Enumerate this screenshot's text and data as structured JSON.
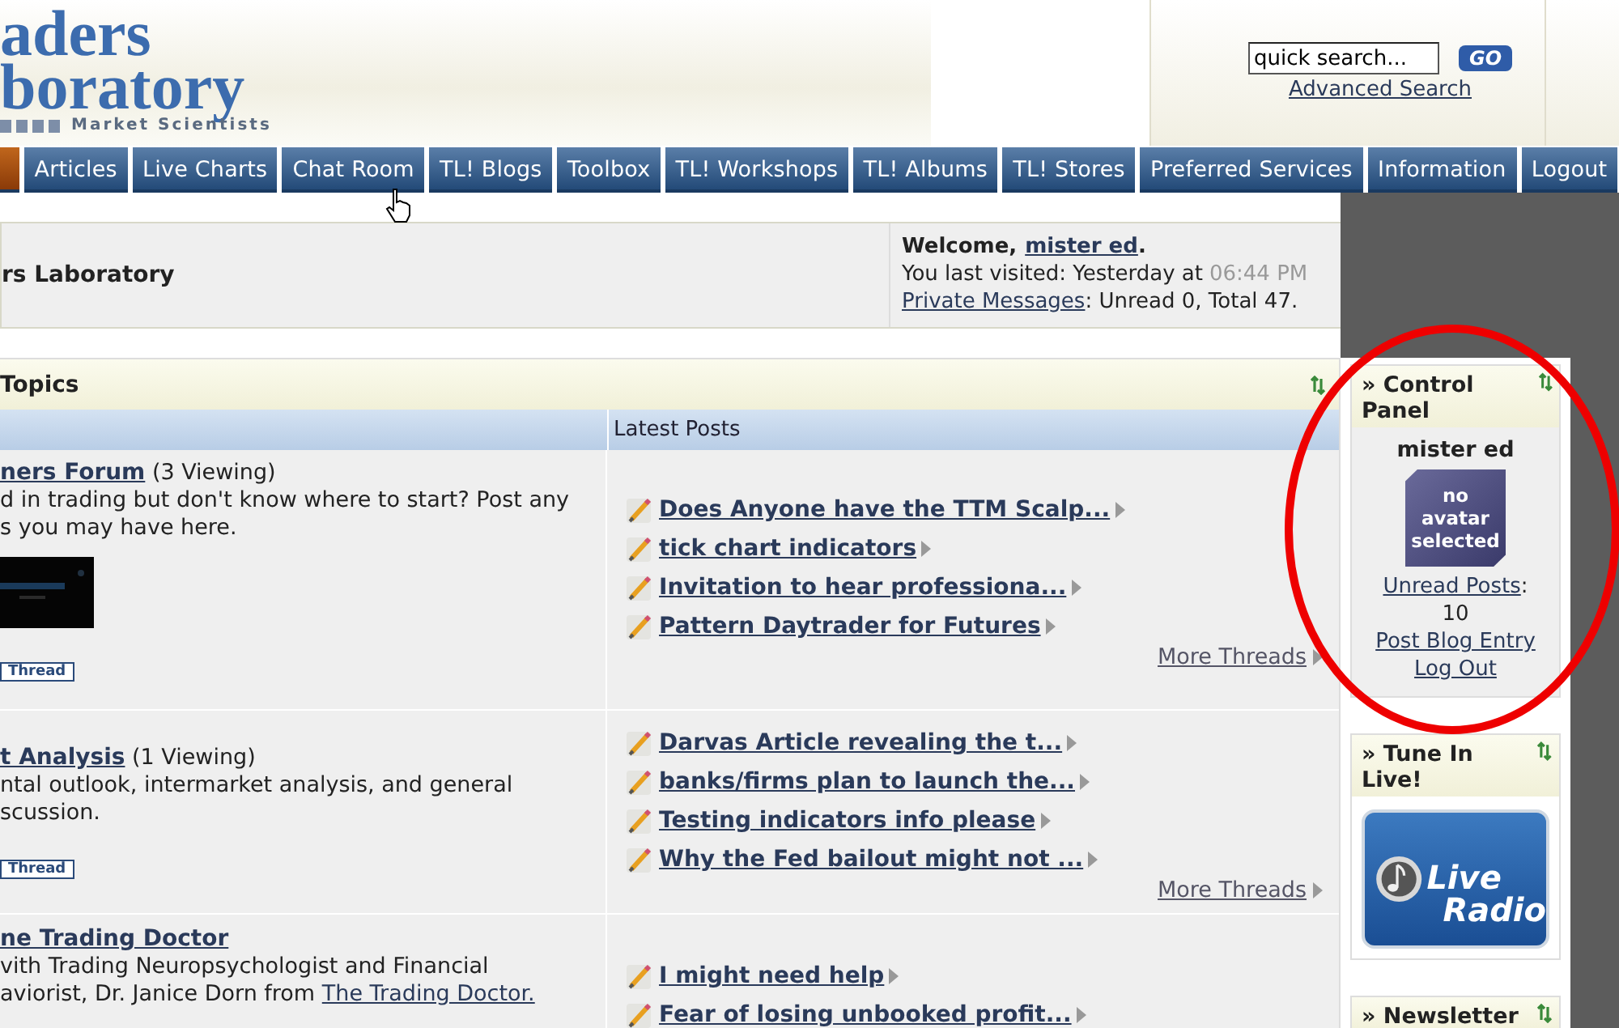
{
  "header": {
    "logo": {
      "line_1": "aders",
      "line_2": "boratory",
      "tagline": "Market Scientists"
    },
    "search": {
      "value": "quick search...",
      "button": "GO",
      "advanced_link": "Advanced Search"
    }
  },
  "nav_tabs": [
    {
      "selected": true
    },
    {
      "label": "Articles",
      "selected": false
    },
    {
      "label": "Live Charts",
      "selected": false
    },
    {
      "label": "Chat Room",
      "selected": false
    },
    {
      "label": "TL! Blogs",
      "selected": false
    },
    {
      "label": "Toolbox",
      "selected": false
    },
    {
      "label": "TL! Workshops",
      "selected": false
    },
    {
      "label": "TL! Albums",
      "selected": false
    },
    {
      "label": "TL! Stores",
      "selected": false
    },
    {
      "label": "Preferred Services",
      "selected": false
    },
    {
      "label": "Information",
      "selected": false
    },
    {
      "label": "Logout",
      "selected": false
    }
  ],
  "welcome_bar": {
    "site_title": "rs Laboratory",
    "greeting": "Welcome,",
    "user_link": "mister ed",
    "greeting_end": ".",
    "last_visited": "You last visited: Yesterday at",
    "last_visited_time": "06:44 PM",
    "messages_link": "Private Messages",
    "messages_summary": ": Unread 0, Total 47."
  },
  "forum_table": {
    "title": "Topics",
    "columns": [
      "Latest Posts"
    ],
    "rows": [
      {
        "forum_link": "ners Forum",
        "viewing": "(3 Viewing)",
        "description_lines": [
          "d in trading but don't know where to start? Post any",
          "s you may have here."
        ],
        "banner": {
          "kind": "picture"
        },
        "thread_button": "Thread",
        "posts": [
          "Does Anyone have the TTM Scalp...",
          "tick chart indicators",
          "Invitation to hear professiona...",
          "Pattern Daytrader for Futures"
        ],
        "more_link": "More Threads"
      },
      {
        "forum_link": "t Analysis",
        "viewing": "(1 Viewing)",
        "description_lines": [
          "ntal outlook, intermarket analysis, and general",
          "scussion."
        ],
        "thread_button": "Thread",
        "posts": [
          "Darvas Article revealing the t...",
          "banks/firms plan to launch the...",
          "Testing indicators info please",
          "Why the Fed bailout might not ..."
        ],
        "more_link": "More Threads"
      },
      {
        "forum_link": "ne Trading Doctor",
        "description_lines": [
          "vith Trading Neuropsychologist and Financial",
          "aviorist, Dr. Janice Dorn from"
        ],
        "description_link": "The Trading Doctor.",
        "posts": [
          "I might need help",
          "Fear of losing unbooked profit..."
        ]
      }
    ]
  },
  "sidebar": [
    {
      "kind": "control_panel",
      "title": "» Control Panel",
      "username": "mister ed",
      "avatar_text": "no avatar selected",
      "unread_link": "Unread Posts",
      "unread_sep": ":",
      "unread_count": "10",
      "links": [
        "Post Blog Entry",
        "Log Out"
      ]
    },
    {
      "kind": "radio",
      "title": "» Tune In Live!",
      "badge_lines": [
        "Live",
        "Radio"
      ]
    },
    {
      "kind": "newsletter",
      "title": "» Newsletter"
    }
  ],
  "annotation": {
    "kind": "ellipse"
  }
}
